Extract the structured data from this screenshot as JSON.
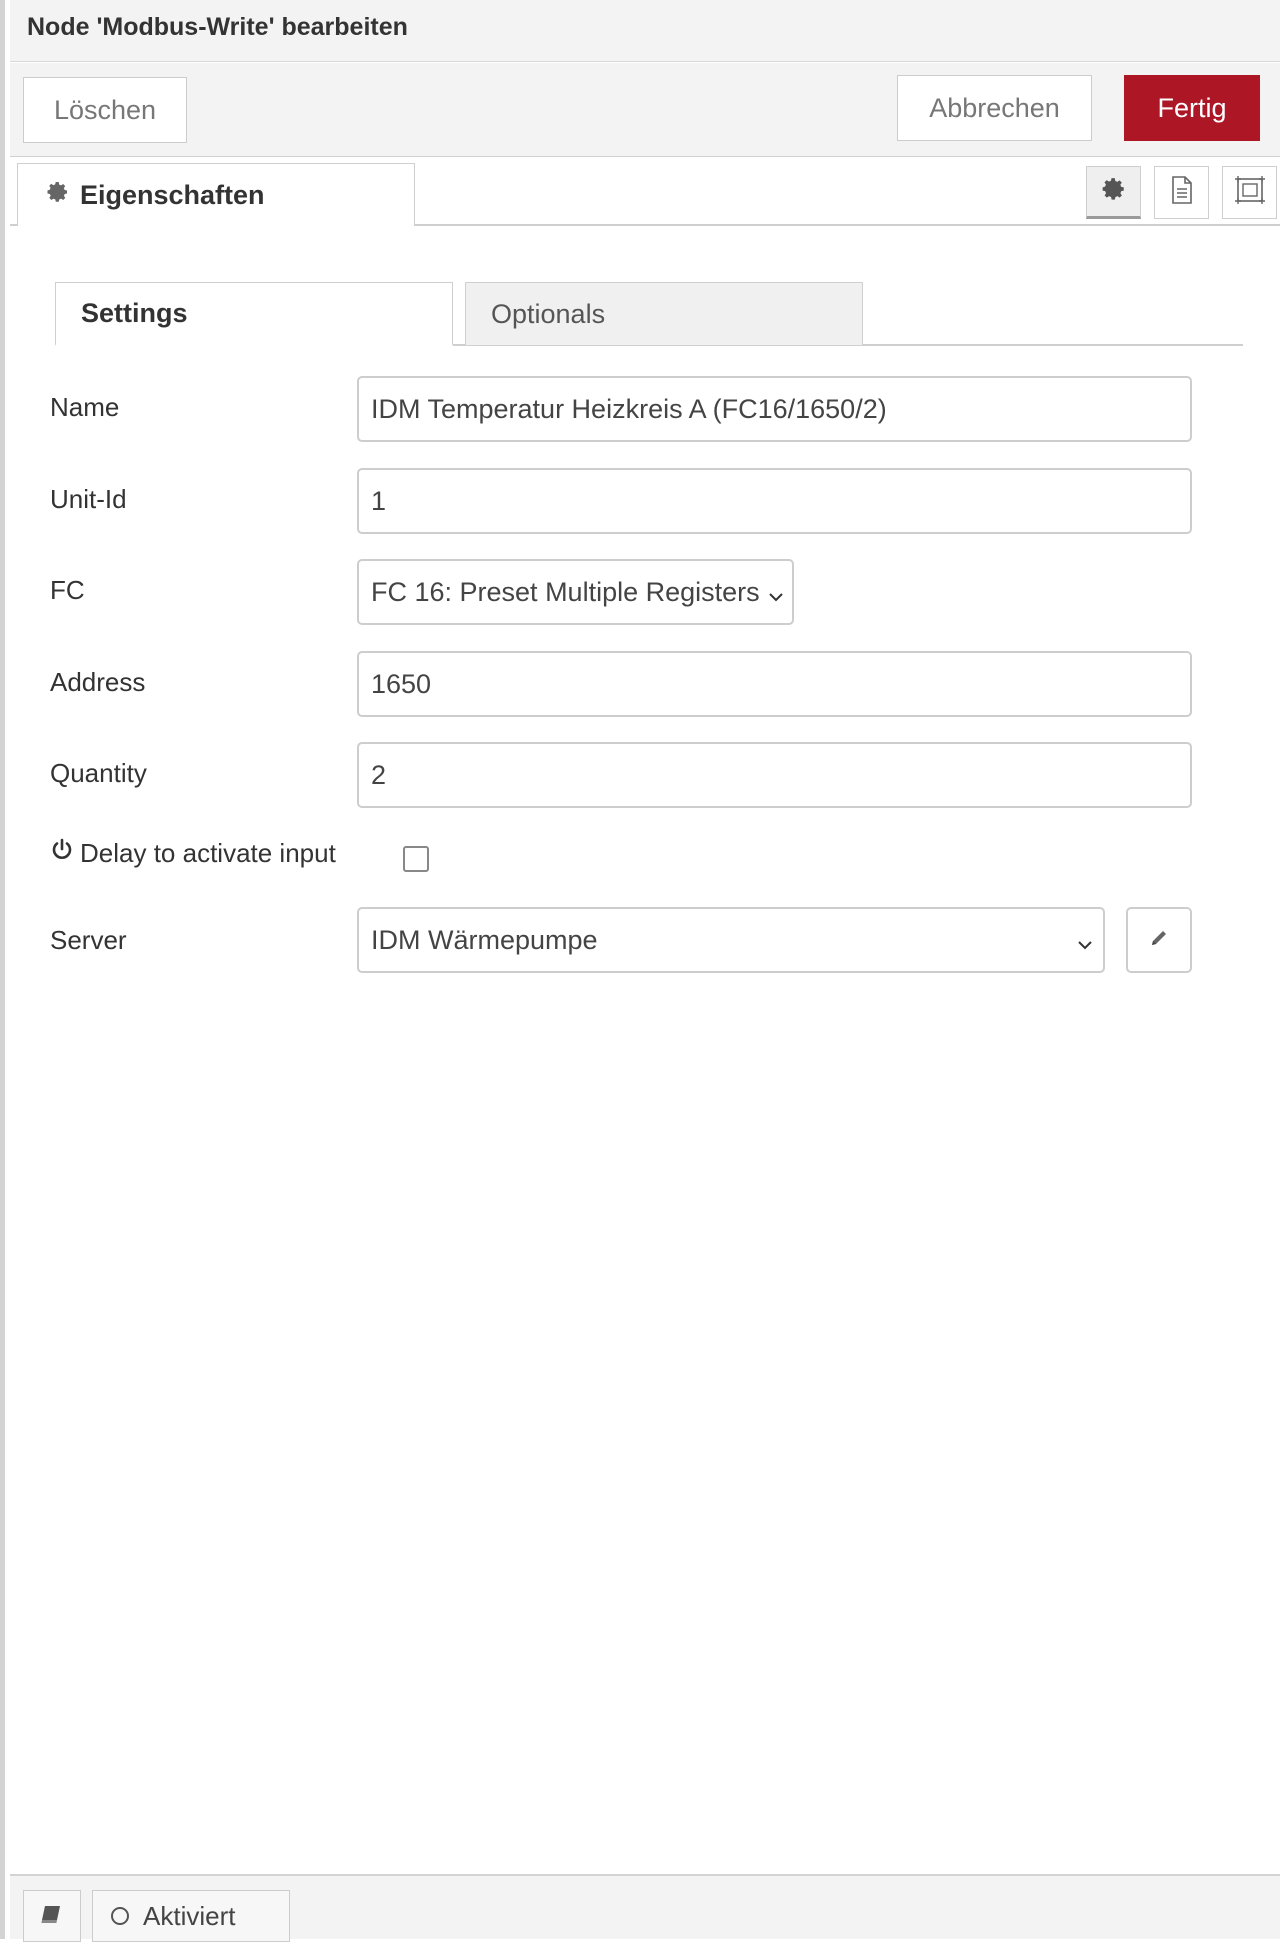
{
  "header": {
    "title": "Node 'Modbus-Write' bearbeiten"
  },
  "toolbar": {
    "delete_label": "Löschen",
    "cancel_label": "Abbrechen",
    "done_label": "Fertig"
  },
  "tabs": {
    "properties_label": "Eigenschaften"
  },
  "subtabs": {
    "settings_label": "Settings",
    "optionals_label": "Optionals"
  },
  "form": {
    "name_label": "Name",
    "name_value": "IDM Temperatur Heizkreis A (FC16/1650/2)",
    "unitid_label": "Unit-Id",
    "unitid_value": "1",
    "fc_label": "FC",
    "fc_value": "FC 16: Preset Multiple Registers",
    "address_label": "Address",
    "address_value": "1650",
    "quantity_label": "Quantity",
    "quantity_value": "2",
    "delay_label": "Delay to activate input",
    "delay_checked": false,
    "server_label": "Server",
    "server_value": "IDM Wärmepumpe"
  },
  "footer": {
    "status_label": "Aktiviert"
  },
  "colors": {
    "accent": "#ad1625",
    "border": "#cdcdcd",
    "panel": "#f3f3f3"
  },
  "icons": [
    "gear-icon",
    "document-icon",
    "frame-icon",
    "chevron-down-icon",
    "pencil-icon",
    "power-icon",
    "book-icon",
    "circle-icon"
  ]
}
